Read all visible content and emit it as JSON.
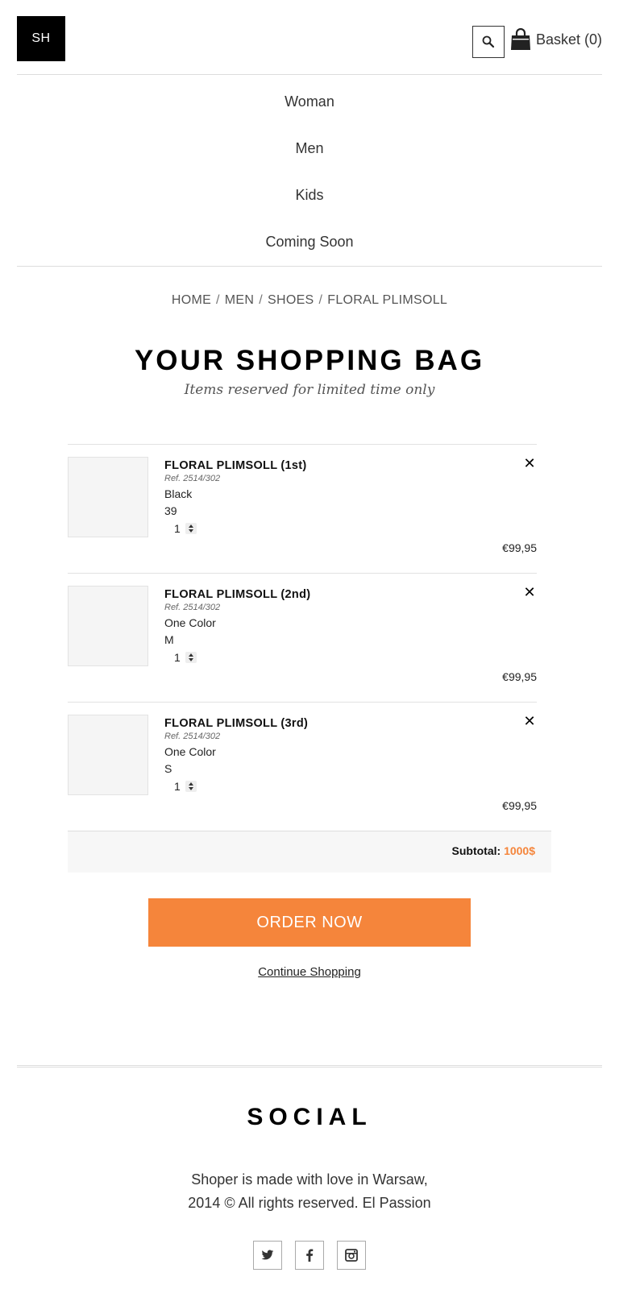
{
  "header": {
    "logo": "SH",
    "search_icon": "search-icon",
    "basket_icon": "shopping-bag-icon",
    "basket_label": "Basket (0)"
  },
  "nav": {
    "items": [
      {
        "label": "Woman"
      },
      {
        "label": "Men"
      },
      {
        "label": "Kids"
      },
      {
        "label": "Coming Soon"
      }
    ]
  },
  "breadcrumb": {
    "items": [
      "HOME",
      "MEN",
      "SHOES",
      "FLORAL PLIMSOLL"
    ],
    "separator": "/"
  },
  "page": {
    "title": "YOUR SHOPPING BAG",
    "subtitle": "Items reserved for limited time only"
  },
  "cart": {
    "items": [
      {
        "name": "FLORAL PLIMSOLL (1st)",
        "ref": "Ref. 2514/302",
        "color": "Black",
        "size": "39",
        "quantity": "1",
        "price": "€99,95"
      },
      {
        "name": "FLORAL PLIMSOLL (2nd)",
        "ref": "Ref. 2514/302",
        "color": "One Color",
        "size": "M",
        "quantity": "1",
        "price": "€99,95"
      },
      {
        "name": "FLORAL PLIMSOLL (3rd)",
        "ref": "Ref. 2514/302",
        "color": "One Color",
        "size": "S",
        "quantity": "1",
        "price": "€99,95"
      }
    ],
    "remove_symbol": "✕",
    "subtotal_label": "Subtotal:",
    "subtotal_value": "1000$",
    "order_label": "ORDER NOW",
    "continue_label": "Continue Shopping"
  },
  "footer": {
    "social_title": "SOCIAL",
    "text_line1": "Shoper is made with love in Warsaw,",
    "text_line2": "2014 © All rights reserved. El Passion",
    "social_icons": [
      "twitter-icon",
      "facebook-icon",
      "instagram-icon"
    ]
  },
  "colors": {
    "accent": "#f5853b",
    "logo_bg": "#000000"
  }
}
